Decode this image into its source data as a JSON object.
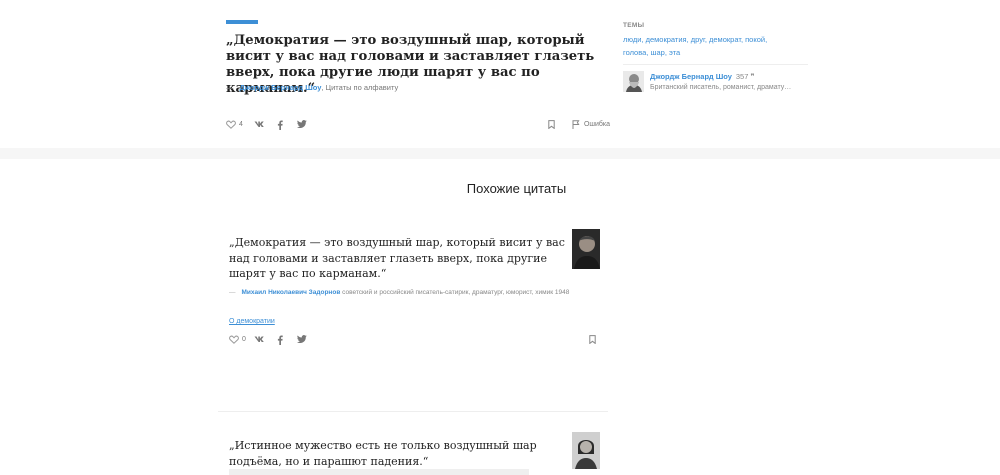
{
  "quote": {
    "text": "„Демократия — это воздушный шар, который висит у вас над головами и заставляет глазеть вверх, пока другие люди шарят у вас по карманам.“",
    "dash": "—",
    "author": "Джордж Бернард Шоу",
    "source": ", Цитаты по алфавиту",
    "likes": "4",
    "error_label": "Ошибка"
  },
  "sidebar": {
    "topics_heading": "ТЕМЫ",
    "topics": [
      "люди",
      "демократия",
      "друг",
      "демократ",
      "покой",
      "голова",
      "шар",
      "эта"
    ],
    "author_name": "Джордж Бернард Шоу",
    "author_count": "357 ❞",
    "author_desc": "Британский писатель, романист, драмату…"
  },
  "similar": {
    "title": "Похожие цитаты",
    "items": [
      {
        "text": "„Демократия — это воздушный шар, который висит у вас над головами и заставляет глазеть вверх, пока другие шарят у вас по карманам.“",
        "dash": "—",
        "author": "Михаил Николаевич Задорнов",
        "desc": " советский и российский писатель-сатирик, драматург, юморист, химик 1948",
        "tag": "О демократии",
        "likes": "0"
      },
      {
        "text": "„Истинное мужество есть не только воздушный шар подъёма, но и парашют падения.“"
      }
    ]
  },
  "colors": {
    "accent": "#3d8fd6",
    "band": "#f6f6f6"
  }
}
